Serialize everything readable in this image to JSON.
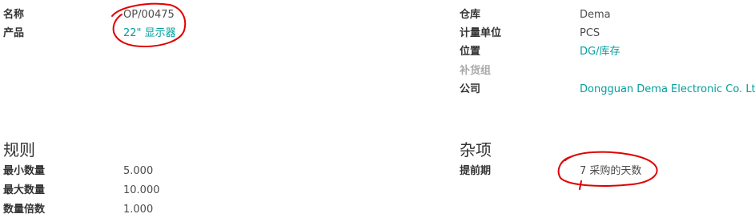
{
  "general": {
    "name_label": "名称",
    "name_value": "OP/00475",
    "product_label": "产品",
    "product_value": "22\" 显示器",
    "warehouse_label": "仓库",
    "warehouse_value": "Dema",
    "uom_label": "计量单位",
    "uom_value": "PCS",
    "location_label": "位置",
    "location_value": "DG/库存",
    "procurement_group_label": "补货组",
    "company_label": "公司",
    "company_value": "Dongguan Dema Electronic Co. Ltd."
  },
  "rules": {
    "title": "规则",
    "min_qty_label": "最小数量",
    "min_qty_value": "5.000",
    "max_qty_label": "最大数量",
    "max_qty_value": "10.000",
    "multiple_qty_label": "数量倍数",
    "multiple_qty_value": "1.000"
  },
  "misc": {
    "title": "杂项",
    "lead_time_label": "提前期",
    "lead_time_value": "7 采购的天数"
  },
  "annotation": {
    "color": "#e00000"
  }
}
